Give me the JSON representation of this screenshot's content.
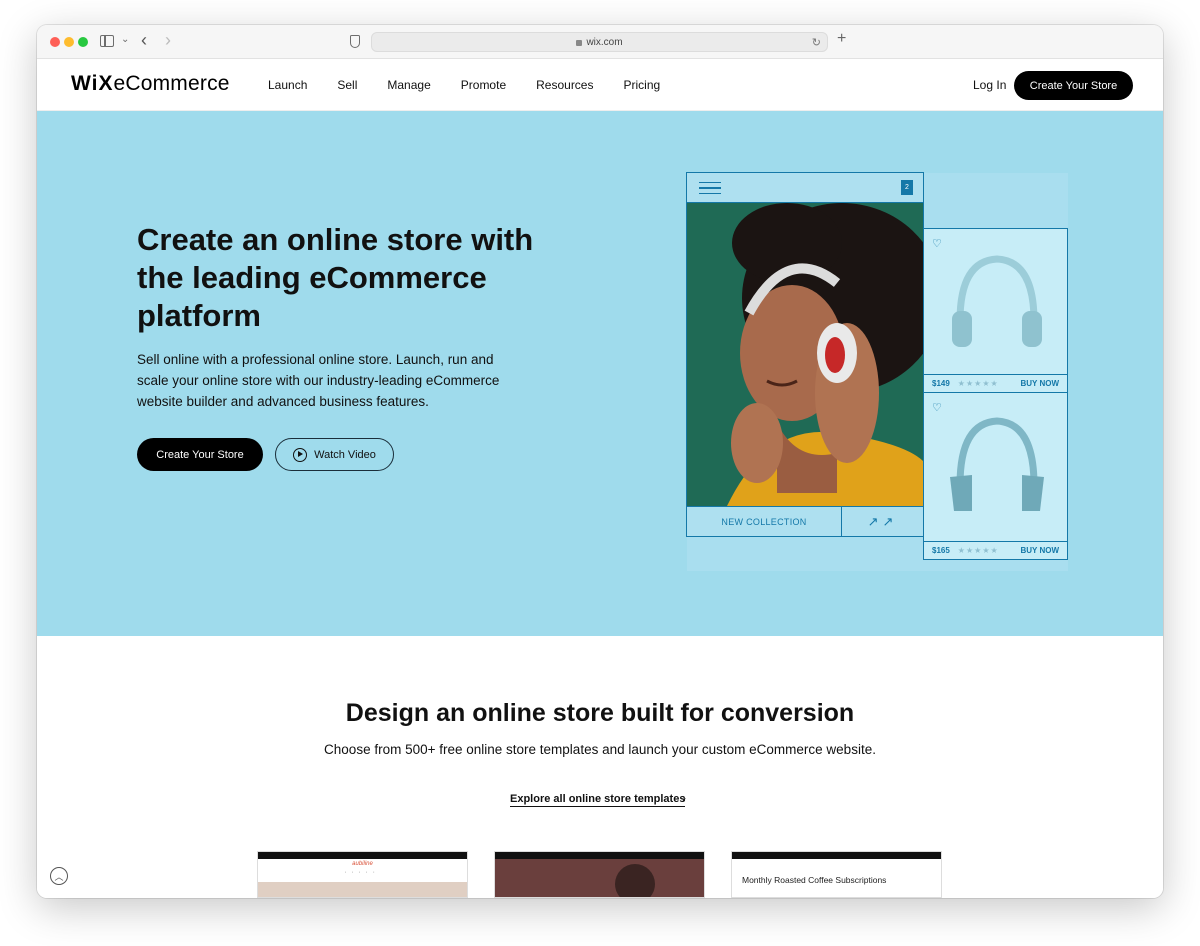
{
  "browser": {
    "url": "wix.com"
  },
  "header": {
    "logo_wix": "WiX",
    "logo_product": "eCommerce",
    "nav": [
      "Launch",
      "Sell",
      "Manage",
      "Promote",
      "Resources",
      "Pricing"
    ],
    "login": "Log In",
    "cta": "Create Your Store"
  },
  "hero": {
    "title": "Create an online store with the leading eCommerce platform",
    "subtitle": "Sell online with a professional online store. Launch, run and scale your online store with our industry-leading eCommerce website builder and advanced business features.",
    "primary_button": "Create Your Store",
    "secondary_button": "Watch Video"
  },
  "mockup": {
    "cart_count": "2",
    "collection_label": "NEW COLLECTION",
    "products": [
      {
        "price": "$149",
        "stars": "★★★★★",
        "action": "BUY NOW"
      },
      {
        "price": "$165",
        "stars": "★★★★★",
        "action": "BUY NOW"
      }
    ],
    "colors": {
      "outline": "#1478a8",
      "hero_bg": "#9fdbec"
    }
  },
  "section": {
    "title": "Design an online store built for conversion",
    "subtitle": "Choose from 500+ free online store templates and launch your custom eCommerce website.",
    "link": "Explore all online store templates"
  },
  "templates": [
    {
      "brand": "aubiline"
    },
    {
      "brand": ""
    },
    {
      "headline": "Monthly Roasted Coffee Subscriptions"
    }
  ]
}
